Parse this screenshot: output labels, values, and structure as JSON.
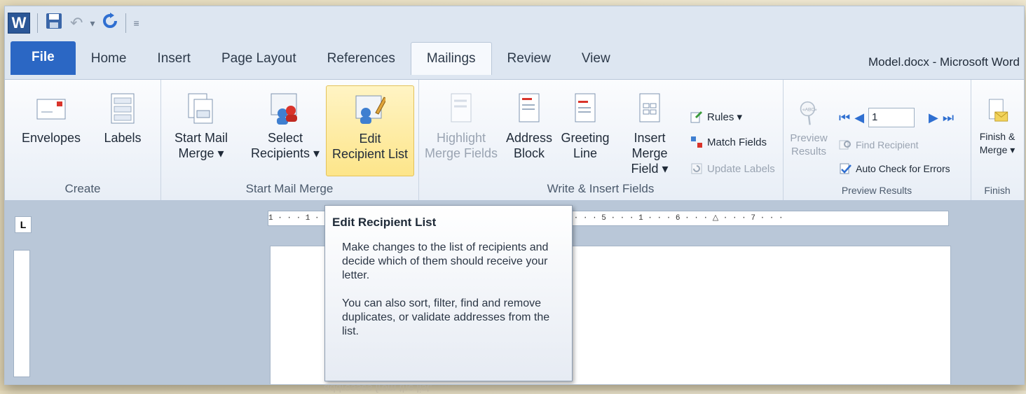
{
  "window": {
    "title": "Model.docx - Microsoft Word"
  },
  "qat": {
    "logo": "W",
    "icons": [
      "word-logo-icon",
      "save-icon",
      "undo-icon",
      "redo-icon",
      "customize-icon"
    ]
  },
  "tabs": [
    "File",
    "Home",
    "Insert",
    "Page Layout",
    "References",
    "Mailings",
    "Review",
    "View"
  ],
  "active_tab": "Mailings",
  "groups": {
    "create": {
      "label": "Create",
      "envelopes": "Envelopes",
      "labels": "Labels"
    },
    "start_mail_merge": {
      "label": "Start Mail Merge",
      "start_line1": "Start Mail",
      "start_line2": "Merge ▾",
      "select_line1": "Select",
      "select_line2": "Recipients ▾",
      "edit_line1": "Edit",
      "edit_line2": "Recipient List"
    },
    "write_insert": {
      "label": "Write & Insert Fields",
      "highlight_line1": "Highlight",
      "highlight_line2": "Merge Fields",
      "address_line1": "Address",
      "address_line2": "Block",
      "greeting_line1": "Greeting",
      "greeting_line2": "Line",
      "insert_line1": "Insert Merge",
      "insert_line2": "Field ▾",
      "rules": "Rules ▾",
      "match_fields": "Match Fields",
      "update_labels": "Update Labels"
    },
    "preview": {
      "label": "Preview Results",
      "preview_line1": "Preview",
      "preview_line2": "Results",
      "record": "1",
      "find_recipient": "Find Recipient",
      "auto_check": "Auto Check for Errors"
    },
    "finish": {
      "label": "Finish",
      "finish_line1": "Finish &",
      "finish_line2": "Merge ▾"
    }
  },
  "ruler": {
    "text": "1 · · · 1 · · · 1 · · · 2 · · · 1 · · · 3 · · · 1 · · · 4 · · · 1 · · · 5 · · · 1 · · · 6 · · · △ · · · 7 · · ·"
  },
  "ruler_tab_selector": "L",
  "tooltip": {
    "title": "Edit Recipient List",
    "p1": "Make changes to the list of recipients and decide which of them should receive your letter.",
    "p2": "You can also sort, filter, find and remove duplicates, or validate addresses from the list."
  },
  "reflection": "addresses from the list."
}
